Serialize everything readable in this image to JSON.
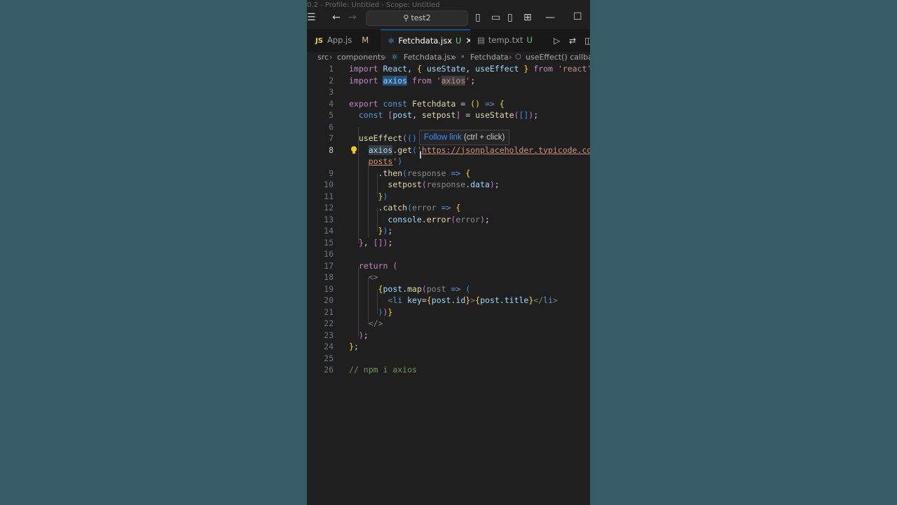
{
  "titlebar": {
    "faint_text": "0.2 - Profile: Untitled - Scope: Untitled",
    "search": "test2"
  },
  "tabs": [
    {
      "icon": "JS",
      "label": "App.js",
      "status": "M"
    },
    {
      "icon": "react-icon",
      "label": "Fetchdata.jsx",
      "status": "U",
      "active": true
    },
    {
      "icon": "file-icon",
      "label": "temp.txt",
      "status": "U"
    }
  ],
  "breadcrumb": [
    "src",
    "components",
    "Fetchdata.jsx",
    "Fetchdata",
    "useEffect() callback"
  ],
  "tooltip": {
    "link": "Follow link",
    "hint": "(ctrl + click)"
  },
  "code": {
    "line_numbers": [
      "1",
      "2",
      "3",
      "4",
      "5",
      "6",
      "7",
      "8",
      "",
      "9",
      "10",
      "11",
      "12",
      "13",
      "14",
      "15",
      "16",
      "17",
      "18",
      "19",
      "20",
      "21",
      "22",
      "23",
      "24",
      "25",
      "26"
    ],
    "url": "https://jsonplaceholder.typicode.com/",
    "url_tail": "posts",
    "comment": "// npm i axios"
  },
  "colors": {
    "background": "#335b67",
    "editor": "#1f1f1f",
    "accent": "#0078d4"
  }
}
